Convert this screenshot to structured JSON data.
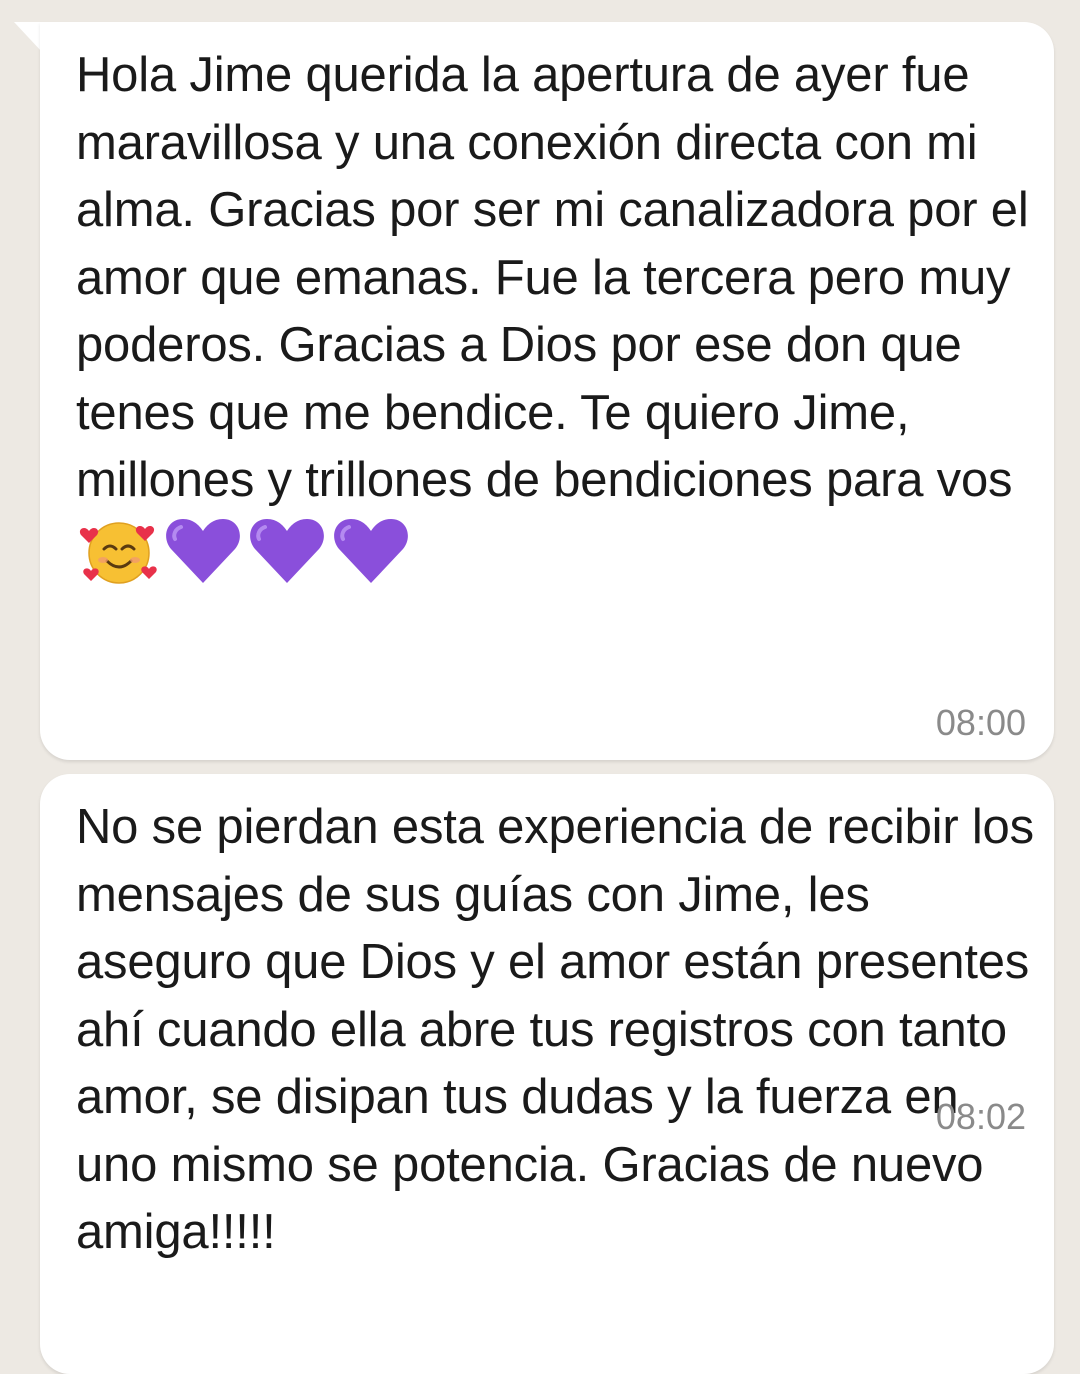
{
  "messages": [
    {
      "text": "Hola Jime querida la apertura de ayer fue maravillosa y una conexión directa con mi alma. Gracias por ser mi canalizadora por el amor que emanas. Fue la tercera pero muy poderos. Gracias a Dios por ese don que tenes que me bendice. Te quiero Jime, millones y trillones de bendiciones para vos",
      "emojis": [
        "smiling-face-with-hearts",
        "purple-heart",
        "purple-heart",
        "purple-heart"
      ],
      "time": "08:00"
    },
    {
      "text": "No se pierdan esta experiencia de recibir los mensajes de sus guías con Jime, les aseguro que Dios y el amor están presentes ahí cuando ella abre tus registros con tanto amor, se disipan tus dudas y la fuerza en uno mismo se potencia. Gracias de nuevo amiga!!!!!",
      "time": "08:02"
    }
  ],
  "colors": {
    "background": "#ede9e3",
    "bubble": "#ffffff",
    "text": "#1a1a1a",
    "timestamp": "#8a8a8a",
    "purple_heart": "#8a4fdb"
  }
}
